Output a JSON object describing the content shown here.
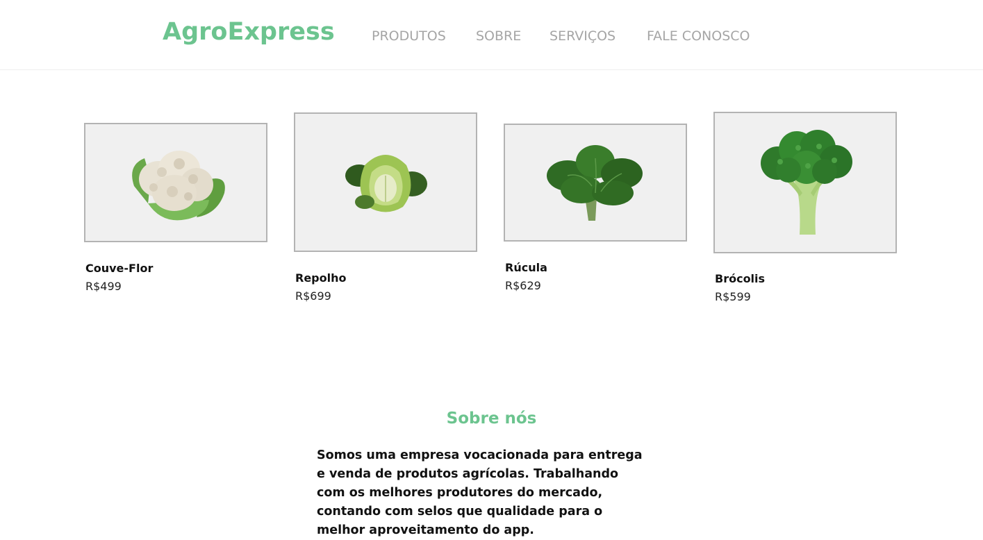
{
  "header": {
    "logo": "AgroExpress",
    "nav": [
      "PRODUTOS",
      "SOBRE",
      "SERVIÇOS",
      "FALE CONOSCO"
    ]
  },
  "products": [
    {
      "name": "Couve-Flor",
      "price": "R$499",
      "image": "cauliflower-image"
    },
    {
      "name": "Repolho",
      "price": "R$699",
      "image": "cabbage-image"
    },
    {
      "name": "Rúcula",
      "price": "R$629",
      "image": "arugula-image"
    },
    {
      "name": "Brócolis",
      "price": "R$599",
      "image": "broccoli-image"
    }
  ],
  "about": {
    "title": "Sobre nós",
    "text": "Somos uma empresa vocacionada para entrega e venda de produtos agrícolas. Trabalhando com os melhores produtores do mercado, contando com selos que qualidade para o melhor aproveitamento do app."
  },
  "colors": {
    "brand": "#6cc48f",
    "nav": "#a5a5a5",
    "card_bg": "#f0f0f0",
    "card_border": "#b3b3b3"
  }
}
